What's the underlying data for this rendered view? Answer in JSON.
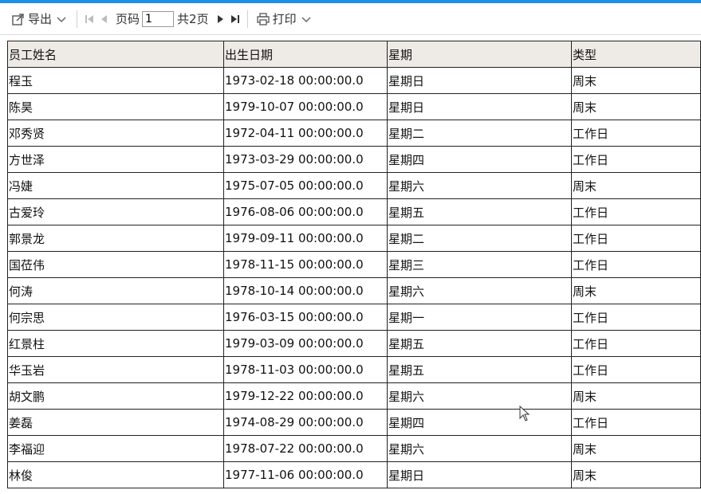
{
  "toolbar": {
    "export_label": "导出",
    "page_label": "页码",
    "page_value": "1",
    "total_pages_label": "共2页",
    "print_label": "打印",
    "icons": {
      "export": "export-icon",
      "first": "first-page-icon",
      "prev": "prev-page-icon",
      "next": "next-page-icon",
      "last": "last-page-icon",
      "print": "printer-icon",
      "dropdown": "chevron-down-icon"
    },
    "accent_color": "#1e90e8"
  },
  "table": {
    "headers": [
      "员工姓名",
      "出生日期",
      "星期",
      "类型"
    ],
    "header_bg": "#eeebe6",
    "rows": [
      [
        "程玉",
        "1973-02-18 00:00:00.0",
        "星期日",
        "周末"
      ],
      [
        "陈昊",
        "1979-10-07 00:00:00.0",
        "星期日",
        "周末"
      ],
      [
        "邓秀贤",
        "1972-04-11 00:00:00.0",
        "星期二",
        "工作日"
      ],
      [
        "方世泽",
        "1973-03-29 00:00:00.0",
        "星期四",
        "工作日"
      ],
      [
        "冯婕",
        "1975-07-05 00:00:00.0",
        "星期六",
        "周末"
      ],
      [
        "古爱玲",
        "1976-08-06 00:00:00.0",
        "星期五",
        "工作日"
      ],
      [
        "郭景龙",
        "1979-09-11 00:00:00.0",
        "星期二",
        "工作日"
      ],
      [
        "国莅伟",
        "1978-11-15 00:00:00.0",
        "星期三",
        "工作日"
      ],
      [
        "何涛",
        "1978-10-14 00:00:00.0",
        "星期六",
        "周末"
      ],
      [
        "何宗思",
        "1976-03-15 00:00:00.0",
        "星期一",
        "工作日"
      ],
      [
        "红景柱",
        "1979-03-09 00:00:00.0",
        "星期五",
        "工作日"
      ],
      [
        "华玉岩",
        "1978-11-03 00:00:00.0",
        "星期五",
        "工作日"
      ],
      [
        "胡文鹏",
        "1979-12-22 00:00:00.0",
        "星期六",
        "周末"
      ],
      [
        "姜磊",
        "1974-08-29 00:00:00.0",
        "星期四",
        "工作日"
      ],
      [
        "李福迎",
        "1978-07-22 00:00:00.0",
        "星期六",
        "周末"
      ],
      [
        "林俊",
        "1977-11-06 00:00:00.0",
        "星期日",
        "周末"
      ]
    ]
  }
}
